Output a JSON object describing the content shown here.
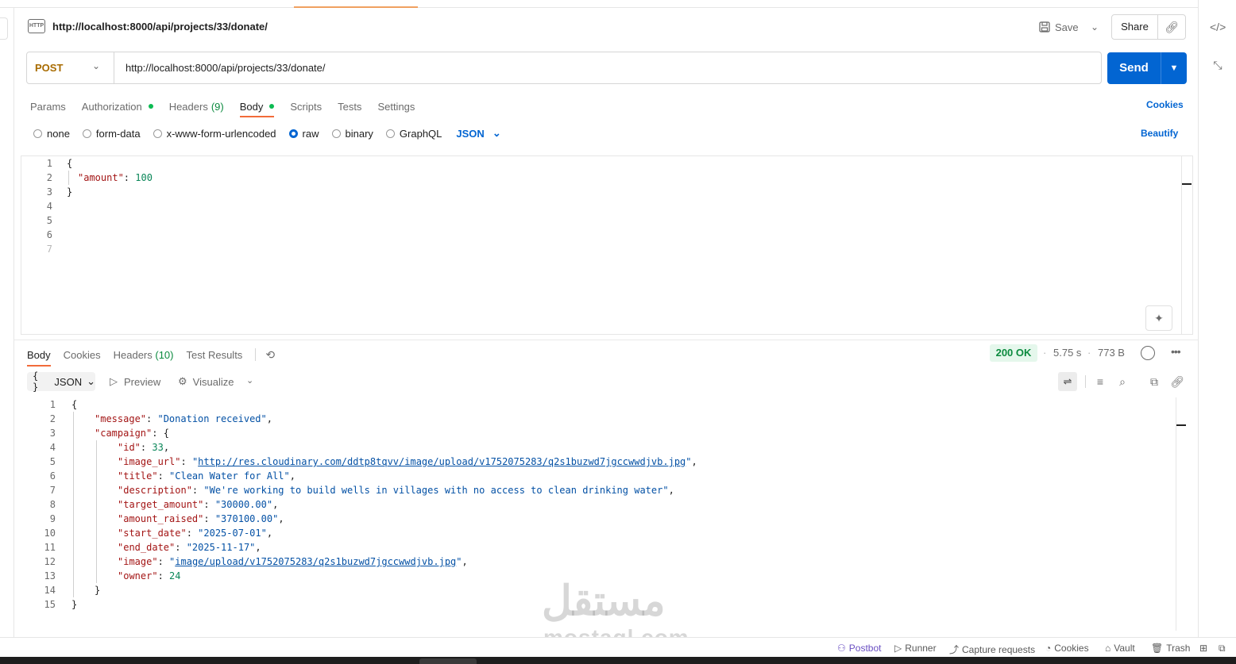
{
  "request": {
    "title": "http://localhost:8000/api/projects/33/donate/",
    "save_label": "Save",
    "share_label": "Share",
    "method": "POST",
    "url": "http://localhost:8000/api/projects/33/donate/",
    "send_label": "Send",
    "icon_text": "HTTP"
  },
  "request_tabs": [
    {
      "label": "Params"
    },
    {
      "label": "Authorization",
      "dot": true
    },
    {
      "label": "Headers",
      "count": "(9)"
    },
    {
      "label": "Body",
      "dot": true,
      "active": true
    },
    {
      "label": "Scripts"
    },
    {
      "label": "Tests"
    },
    {
      "label": "Settings"
    }
  ],
  "cookies_label": "Cookies",
  "body_options": [
    "none",
    "form-data",
    "x-www-form-urlencoded",
    "raw",
    "binary",
    "GraphQL"
  ],
  "body_selected": "raw",
  "body_format": "JSON",
  "beautify_label": "Beautify",
  "request_body": {
    "line_numbers": [
      "1",
      "2",
      "3",
      "4",
      "5",
      "6",
      "7"
    ],
    "open": "{",
    "key": "\"amount\"",
    "value": "100",
    "close": "}"
  },
  "response_tabs": [
    {
      "label": "Body",
      "active": true
    },
    {
      "label": "Cookies"
    },
    {
      "label": "Headers",
      "count": "(10)"
    },
    {
      "label": "Test Results"
    }
  ],
  "response_meta": {
    "status": "200 OK",
    "time": "5.75 s",
    "size": "773 B"
  },
  "response_toolbar": {
    "format": "JSON",
    "preview": "Preview",
    "visualize": "Visualize"
  },
  "response_body": {
    "line_numbers": [
      "1",
      "2",
      "3",
      "4",
      "5",
      "6",
      "7",
      "8",
      "9",
      "10",
      "11",
      "12",
      "13",
      "14",
      "15"
    ],
    "message_key": "\"message\"",
    "message_val": "\"Donation received\"",
    "campaign_key": "\"campaign\"",
    "fields": [
      {
        "key": "\"id\"",
        "value": "33",
        "type": "num"
      },
      {
        "key": "\"image_url\"",
        "value": "http://res.cloudinary.com/ddtp8tqvv/image/upload/v1752075283/q2s1buzwd7jgccwwdjvb.jpg",
        "type": "url"
      },
      {
        "key": "\"title\"",
        "value": "\"Clean Water for All\"",
        "type": "str"
      },
      {
        "key": "\"description\"",
        "value": "\"We're working to build wells in villages with no access to clean drinking water\"",
        "type": "str"
      },
      {
        "key": "\"target_amount\"",
        "value": "\"30000.00\"",
        "type": "str"
      },
      {
        "key": "\"amount_raised\"",
        "value": "\"370100.00\"",
        "type": "str"
      },
      {
        "key": "\"start_date\"",
        "value": "\"2025-07-01\"",
        "type": "str"
      },
      {
        "key": "\"end_date\"",
        "value": "\"2025-11-17\"",
        "type": "str"
      },
      {
        "key": "\"image\"",
        "value": "image/upload/v1752075283/q2s1buzwd7jgccwwdjvb.jpg",
        "type": "path"
      },
      {
        "key": "\"owner\"",
        "value": "24",
        "type": "num"
      }
    ]
  },
  "watermark": {
    "arabic": "مستقل",
    "latin": "mostaql.com"
  },
  "footer": {
    "postbot": "Postbot",
    "runner": "Runner",
    "capture": "Capture requests",
    "cookies": "Cookies",
    "vault": "Vault",
    "trash": "Trash"
  },
  "colors": {
    "send_blue": "#0265d2",
    "method_post": "#a86b00",
    "status_green": "#0b8a3e",
    "tab_accent": "#f26b3a"
  }
}
